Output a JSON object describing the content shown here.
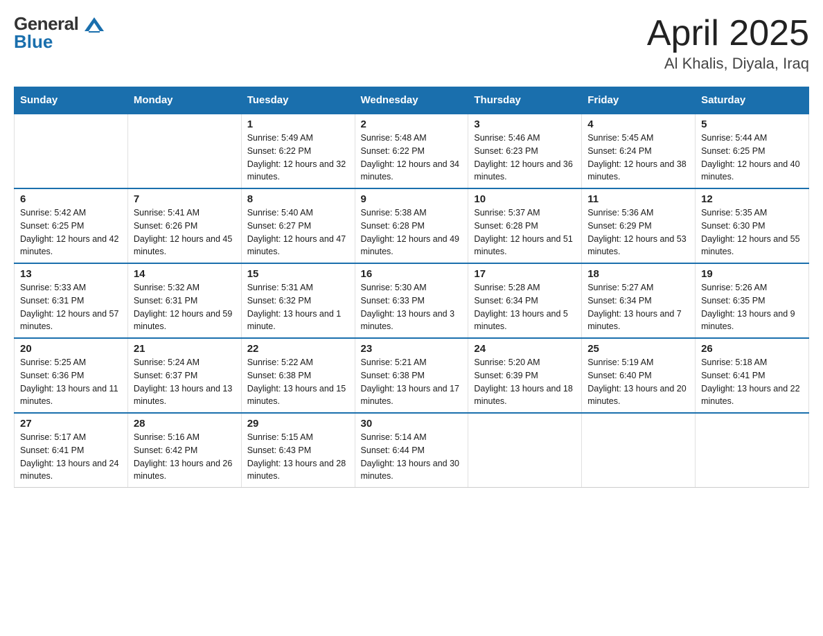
{
  "header": {
    "title": "April 2025",
    "subtitle": "Al Khalis, Diyala, Iraq",
    "logo_general": "General",
    "logo_blue": "Blue"
  },
  "days_of_week": [
    "Sunday",
    "Monday",
    "Tuesday",
    "Wednesday",
    "Thursday",
    "Friday",
    "Saturday"
  ],
  "weeks": [
    [
      {
        "day": "",
        "sunrise": "",
        "sunset": "",
        "daylight": ""
      },
      {
        "day": "",
        "sunrise": "",
        "sunset": "",
        "daylight": ""
      },
      {
        "day": "1",
        "sunrise": "Sunrise: 5:49 AM",
        "sunset": "Sunset: 6:22 PM",
        "daylight": "Daylight: 12 hours and 32 minutes."
      },
      {
        "day": "2",
        "sunrise": "Sunrise: 5:48 AM",
        "sunset": "Sunset: 6:22 PM",
        "daylight": "Daylight: 12 hours and 34 minutes."
      },
      {
        "day": "3",
        "sunrise": "Sunrise: 5:46 AM",
        "sunset": "Sunset: 6:23 PM",
        "daylight": "Daylight: 12 hours and 36 minutes."
      },
      {
        "day": "4",
        "sunrise": "Sunrise: 5:45 AM",
        "sunset": "Sunset: 6:24 PM",
        "daylight": "Daylight: 12 hours and 38 minutes."
      },
      {
        "day": "5",
        "sunrise": "Sunrise: 5:44 AM",
        "sunset": "Sunset: 6:25 PM",
        "daylight": "Daylight: 12 hours and 40 minutes."
      }
    ],
    [
      {
        "day": "6",
        "sunrise": "Sunrise: 5:42 AM",
        "sunset": "Sunset: 6:25 PM",
        "daylight": "Daylight: 12 hours and 42 minutes."
      },
      {
        "day": "7",
        "sunrise": "Sunrise: 5:41 AM",
        "sunset": "Sunset: 6:26 PM",
        "daylight": "Daylight: 12 hours and 45 minutes."
      },
      {
        "day": "8",
        "sunrise": "Sunrise: 5:40 AM",
        "sunset": "Sunset: 6:27 PM",
        "daylight": "Daylight: 12 hours and 47 minutes."
      },
      {
        "day": "9",
        "sunrise": "Sunrise: 5:38 AM",
        "sunset": "Sunset: 6:28 PM",
        "daylight": "Daylight: 12 hours and 49 minutes."
      },
      {
        "day": "10",
        "sunrise": "Sunrise: 5:37 AM",
        "sunset": "Sunset: 6:28 PM",
        "daylight": "Daylight: 12 hours and 51 minutes."
      },
      {
        "day": "11",
        "sunrise": "Sunrise: 5:36 AM",
        "sunset": "Sunset: 6:29 PM",
        "daylight": "Daylight: 12 hours and 53 minutes."
      },
      {
        "day": "12",
        "sunrise": "Sunrise: 5:35 AM",
        "sunset": "Sunset: 6:30 PM",
        "daylight": "Daylight: 12 hours and 55 minutes."
      }
    ],
    [
      {
        "day": "13",
        "sunrise": "Sunrise: 5:33 AM",
        "sunset": "Sunset: 6:31 PM",
        "daylight": "Daylight: 12 hours and 57 minutes."
      },
      {
        "day": "14",
        "sunrise": "Sunrise: 5:32 AM",
        "sunset": "Sunset: 6:31 PM",
        "daylight": "Daylight: 12 hours and 59 minutes."
      },
      {
        "day": "15",
        "sunrise": "Sunrise: 5:31 AM",
        "sunset": "Sunset: 6:32 PM",
        "daylight": "Daylight: 13 hours and 1 minute."
      },
      {
        "day": "16",
        "sunrise": "Sunrise: 5:30 AM",
        "sunset": "Sunset: 6:33 PM",
        "daylight": "Daylight: 13 hours and 3 minutes."
      },
      {
        "day": "17",
        "sunrise": "Sunrise: 5:28 AM",
        "sunset": "Sunset: 6:34 PM",
        "daylight": "Daylight: 13 hours and 5 minutes."
      },
      {
        "day": "18",
        "sunrise": "Sunrise: 5:27 AM",
        "sunset": "Sunset: 6:34 PM",
        "daylight": "Daylight: 13 hours and 7 minutes."
      },
      {
        "day": "19",
        "sunrise": "Sunrise: 5:26 AM",
        "sunset": "Sunset: 6:35 PM",
        "daylight": "Daylight: 13 hours and 9 minutes."
      }
    ],
    [
      {
        "day": "20",
        "sunrise": "Sunrise: 5:25 AM",
        "sunset": "Sunset: 6:36 PM",
        "daylight": "Daylight: 13 hours and 11 minutes."
      },
      {
        "day": "21",
        "sunrise": "Sunrise: 5:24 AM",
        "sunset": "Sunset: 6:37 PM",
        "daylight": "Daylight: 13 hours and 13 minutes."
      },
      {
        "day": "22",
        "sunrise": "Sunrise: 5:22 AM",
        "sunset": "Sunset: 6:38 PM",
        "daylight": "Daylight: 13 hours and 15 minutes."
      },
      {
        "day": "23",
        "sunrise": "Sunrise: 5:21 AM",
        "sunset": "Sunset: 6:38 PM",
        "daylight": "Daylight: 13 hours and 17 minutes."
      },
      {
        "day": "24",
        "sunrise": "Sunrise: 5:20 AM",
        "sunset": "Sunset: 6:39 PM",
        "daylight": "Daylight: 13 hours and 18 minutes."
      },
      {
        "day": "25",
        "sunrise": "Sunrise: 5:19 AM",
        "sunset": "Sunset: 6:40 PM",
        "daylight": "Daylight: 13 hours and 20 minutes."
      },
      {
        "day": "26",
        "sunrise": "Sunrise: 5:18 AM",
        "sunset": "Sunset: 6:41 PM",
        "daylight": "Daylight: 13 hours and 22 minutes."
      }
    ],
    [
      {
        "day": "27",
        "sunrise": "Sunrise: 5:17 AM",
        "sunset": "Sunset: 6:41 PM",
        "daylight": "Daylight: 13 hours and 24 minutes."
      },
      {
        "day": "28",
        "sunrise": "Sunrise: 5:16 AM",
        "sunset": "Sunset: 6:42 PM",
        "daylight": "Daylight: 13 hours and 26 minutes."
      },
      {
        "day": "29",
        "sunrise": "Sunrise: 5:15 AM",
        "sunset": "Sunset: 6:43 PM",
        "daylight": "Daylight: 13 hours and 28 minutes."
      },
      {
        "day": "30",
        "sunrise": "Sunrise: 5:14 AM",
        "sunset": "Sunset: 6:44 PM",
        "daylight": "Daylight: 13 hours and 30 minutes."
      },
      {
        "day": "",
        "sunrise": "",
        "sunset": "",
        "daylight": ""
      },
      {
        "day": "",
        "sunrise": "",
        "sunset": "",
        "daylight": ""
      },
      {
        "day": "",
        "sunrise": "",
        "sunset": "",
        "daylight": ""
      }
    ]
  ]
}
